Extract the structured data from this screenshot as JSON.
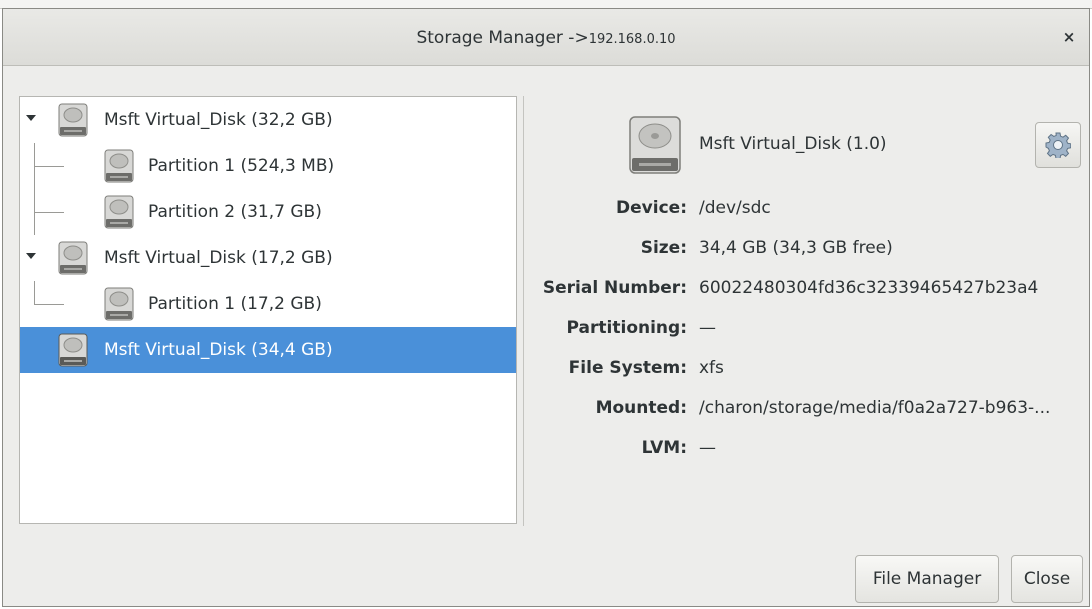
{
  "window": {
    "title": "Storage Manager ->",
    "title_ip": "192.168.0.10",
    "close_glyph": "×"
  },
  "tree": {
    "items": [
      {
        "label": "Msft Virtual_Disk (32,2 GB)",
        "level": 0,
        "expanded": true,
        "selected": false
      },
      {
        "label": "Partition 1 (524,3 MB)",
        "level": 1,
        "selected": false
      },
      {
        "label": "Partition 2 (31,7 GB)",
        "level": 1,
        "selected": false
      },
      {
        "label": "Msft Virtual_Disk (17,2 GB)",
        "level": 0,
        "expanded": true,
        "selected": false
      },
      {
        "label": "Partition 1 (17,2 GB)",
        "level": 1,
        "selected": false
      },
      {
        "label": "Msft Virtual_Disk (34,4 GB)",
        "level": 0,
        "expanded": false,
        "selected": true
      }
    ]
  },
  "details": {
    "name": "Msft Virtual_Disk (1.0)",
    "properties": [
      {
        "key": "Device:",
        "value": "/dev/sdc"
      },
      {
        "key": "Size:",
        "value": "34,4 GB (34,3 GB free)"
      },
      {
        "key": "Serial Number:",
        "value": "60022480304fd36c32339465427b23a4"
      },
      {
        "key": "Partitioning:",
        "value": "—"
      },
      {
        "key": "File System:",
        "value": "xfs"
      },
      {
        "key": "Mounted:",
        "value": "/charon/storage/media/f0a2a727-b963-..."
      },
      {
        "key": "LVM:",
        "value": "—"
      }
    ]
  },
  "buttons": {
    "file_manager": "File Manager",
    "close": "Close"
  },
  "colors": {
    "selection": "#4a90d9",
    "window_bg": "#ededeb"
  }
}
